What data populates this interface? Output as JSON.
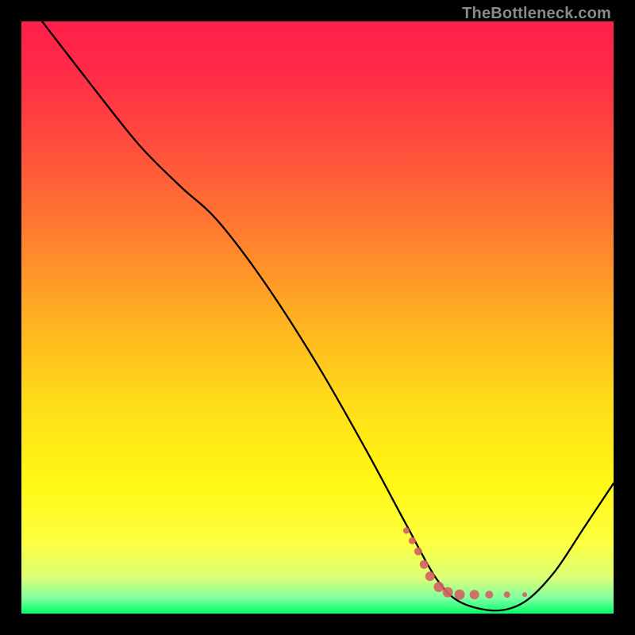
{
  "watermark": "TheBottleneck.com",
  "chart_data": {
    "type": "line",
    "title": "",
    "xlabel": "",
    "ylabel": "",
    "xlim": [
      0,
      100
    ],
    "ylim": [
      0,
      100
    ],
    "gradient_stops": [
      {
        "offset": 0.0,
        "color": "#ff1f4b"
      },
      {
        "offset": 0.08,
        "color": "#ff2a47"
      },
      {
        "offset": 0.2,
        "color": "#ff4a3e"
      },
      {
        "offset": 0.35,
        "color": "#ff7a30"
      },
      {
        "offset": 0.5,
        "color": "#ffb021"
      },
      {
        "offset": 0.65,
        "color": "#ffde18"
      },
      {
        "offset": 0.78,
        "color": "#fff814"
      },
      {
        "offset": 0.88,
        "color": "#fdff40"
      },
      {
        "offset": 0.94,
        "color": "#dbff78"
      },
      {
        "offset": 0.975,
        "color": "#7dffa0"
      },
      {
        "offset": 1.0,
        "color": "#00ff66"
      }
    ],
    "series": [
      {
        "name": "curve",
        "stroke": "#000000",
        "stroke_width": 2.3,
        "points": [
          {
            "x": 3.5,
            "y": 100
          },
          {
            "x": 12,
            "y": 89
          },
          {
            "x": 20,
            "y": 79
          },
          {
            "x": 27,
            "y": 72
          },
          {
            "x": 33,
            "y": 66.5
          },
          {
            "x": 41,
            "y": 56
          },
          {
            "x": 50,
            "y": 42
          },
          {
            "x": 58,
            "y": 28
          },
          {
            "x": 65,
            "y": 15
          },
          {
            "x": 70,
            "y": 6
          },
          {
            "x": 74,
            "y": 2
          },
          {
            "x": 80,
            "y": 0.5
          },
          {
            "x": 85,
            "y": 2
          },
          {
            "x": 90,
            "y": 7
          },
          {
            "x": 95,
            "y": 14.5
          },
          {
            "x": 100,
            "y": 22
          }
        ]
      },
      {
        "name": "marker-trail",
        "type": "scatter",
        "stroke": "#d66060",
        "points": [
          {
            "x": 65,
            "y": 14,
            "r": 4
          },
          {
            "x": 66,
            "y": 12.3,
            "r": 4.5
          },
          {
            "x": 67,
            "y": 10.5,
            "r": 5
          },
          {
            "x": 68,
            "y": 8.3,
            "r": 5.5
          },
          {
            "x": 69,
            "y": 6.3,
            "r": 6
          },
          {
            "x": 70.5,
            "y": 4.5,
            "r": 6.5
          },
          {
            "x": 72,
            "y": 3.6,
            "r": 6.5
          },
          {
            "x": 74,
            "y": 3.2,
            "r": 6.5
          },
          {
            "x": 76.5,
            "y": 3.2,
            "r": 6
          },
          {
            "x": 79,
            "y": 3.2,
            "r": 5
          },
          {
            "x": 82,
            "y": 3.2,
            "r": 4
          },
          {
            "x": 85,
            "y": 3.2,
            "r": 3
          }
        ]
      }
    ]
  }
}
